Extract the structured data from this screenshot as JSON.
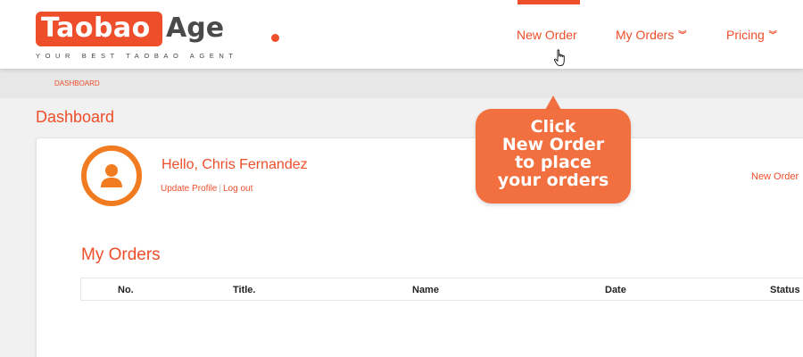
{
  "logo": {
    "name_left": "Taobao",
    "name_right": "Age",
    "tagline": "YOUR BEST TAOBAO AGENT"
  },
  "nav": {
    "new_order": "New Order",
    "my_orders": "My Orders",
    "pricing": "Pricing",
    "chevron": "»"
  },
  "breadcrumb": "DASHBOARD",
  "page_title": "Dashboard",
  "profile": {
    "greeting": "Hello, Chris Fernandez",
    "update_profile": "Update Profile",
    "separator": "|",
    "logout": "Log out"
  },
  "card_new_order": "New Order",
  "orders": {
    "title": "My Orders",
    "columns": [
      "No.",
      "Title.",
      "Name",
      "Date",
      "Status"
    ]
  },
  "callout": {
    "text": "Click\nNew Order\nto place\nyour orders"
  },
  "colors": {
    "accent": "#ee4e2a",
    "avatar_ring": "#f17b21",
    "callout": "#f26f3f"
  },
  "icons": {
    "avatar": "user-icon",
    "cursor": "hand-pointer-icon",
    "chevron": "double-chevron-down-icon"
  }
}
